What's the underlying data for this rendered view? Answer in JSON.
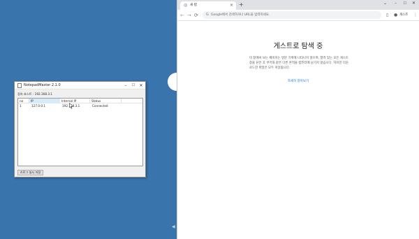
{
  "app": {
    "title": "NotepadMaster 2.1.0",
    "min_label": "–",
    "max_label": "☐",
    "close_label": "✕",
    "server_text": "접속 호스트 : 192.168.3.1",
    "list": {
      "columns": [
        "no",
        "IP",
        "Internal IP",
        "Status"
      ],
      "rows": [
        {
          "no": "1",
          "ip": "127.0.0.1",
          "internal_ip": "192.168.3.1",
          "status": "Connected"
        }
      ]
    },
    "action_button": "키로그 실시 저장"
  },
  "browser": {
    "tab_title": "새 탭",
    "tab_close": "×",
    "new_tab": "+",
    "window_controls": {
      "down": "⌄",
      "min": "–",
      "max": "☐",
      "close": "✕"
    },
    "nav": {
      "back": "←",
      "forward": "→",
      "reload": "⟳"
    },
    "omnibox_placeholder": "Google에서 검색하거나 URL을 입력하세요.",
    "profile_label": "게스트",
    "menu": "⋮",
    "guest_title": "게스트로 탐색 중",
    "guest_desc": "이 창에서 보는 페이지는 방문 기록에 나타나지 않으며, 열려 있는 모든 게스트 창을 닫은 후 쿠키와 같은 다른 흔적을 컴퓨터에 남기지 않습니다. 하지만 다운로드한 파일은 모두 저장됩니다.",
    "learn_more": "자세히 알아보기"
  },
  "icons": {
    "app_icon": "document-icon",
    "tab_icon": "globe-icon",
    "omni_icon": "google-g-icon",
    "sidepanel": "side-panel-icon",
    "profile": "profile-icon",
    "cursor": "mouse-cursor-icon"
  },
  "colors": {
    "desktop": "#3a74ad",
    "link": "#1a73e8",
    "selected_header": "#d9ebf9"
  }
}
